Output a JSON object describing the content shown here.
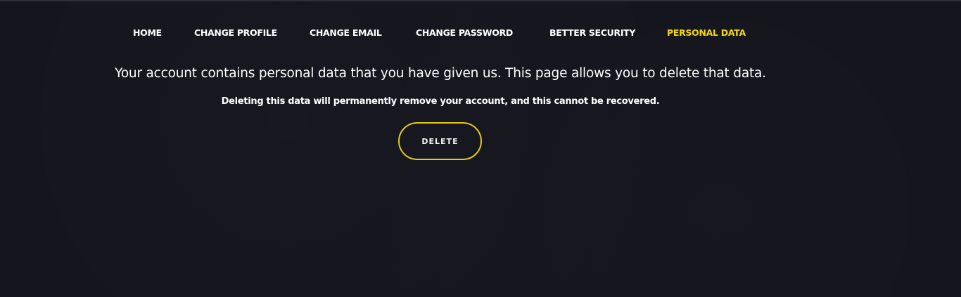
{
  "nav": {
    "items": [
      {
        "label": "HOME",
        "active": false
      },
      {
        "label": "CHANGE PROFILE",
        "active": false
      },
      {
        "label": "CHANGE EMAIL",
        "active": false
      },
      {
        "label": "CHANGE PASSWORD",
        "active": false
      },
      {
        "label": "BETTER SECURITY",
        "active": false
      },
      {
        "label": "PERSONAL DATA",
        "active": true
      }
    ]
  },
  "main": {
    "heading": "Your account contains personal data that you have given us. This page allows you to delete that data.",
    "warning": "Deleting this data will permanently remove your account, and this cannot be recovered.",
    "delete_label": "DELETE"
  },
  "colors": {
    "background": "#14141d",
    "accent": "#f5d90a",
    "button_border": "#e3cb12",
    "text": "#ffffff"
  }
}
